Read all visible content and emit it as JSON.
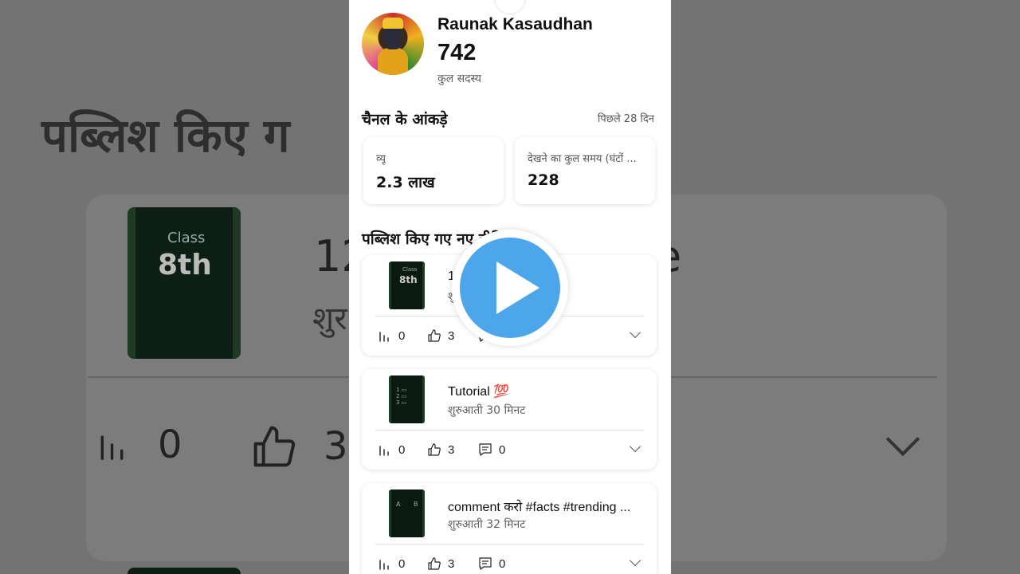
{
  "channel": {
    "name": "Raunak Kasaudhan",
    "subscriber_count": "742",
    "subscriber_label": "कुल सदस्य"
  },
  "analytics": {
    "title": "चैनल के आंकड़े",
    "period": "पिछले 28 दिन",
    "cards": [
      {
        "label": "व्यू",
        "value": "2.3 लाख"
      },
      {
        "label": "देखने का कुल समय (घंटों ...",
        "value": "228"
      }
    ]
  },
  "published": {
    "title": "पब्लिश किए गए नए वीडियो",
    "videos": [
      {
        "title": "1",
        "subtitle": "शु",
        "thumb_top": "Class",
        "thumb_main": "8th",
        "views": "0",
        "likes": "3",
        "comments": ""
      },
      {
        "title": "Tutorial 💯",
        "subtitle": "शुरुआती 30 मिनट",
        "thumb_top": "",
        "thumb_main": "",
        "views": "0",
        "likes": "3",
        "comments": "0"
      },
      {
        "title": "comment करो #facts #trending ...",
        "subtitle": "शुरुआती 32 मिनट",
        "thumb_top": "A",
        "thumb_main": "B",
        "views": "0",
        "likes": "3",
        "comments": "0"
      }
    ]
  },
  "background": {
    "title": "पब्लिश किए ग",
    "thumb_top": "Class",
    "thumb_main": "8th",
    "line1": "12",
    "line2": "शुर",
    "line1_end": "e",
    "views": "0",
    "likes": "3"
  },
  "colors": {
    "play_button": "#4da6ea",
    "backdrop": "#767676",
    "thumbnail": "#0a1a10"
  },
  "icons": [
    "views-icon",
    "like-icon",
    "comment-icon",
    "chevron-down-icon",
    "play-icon"
  ]
}
